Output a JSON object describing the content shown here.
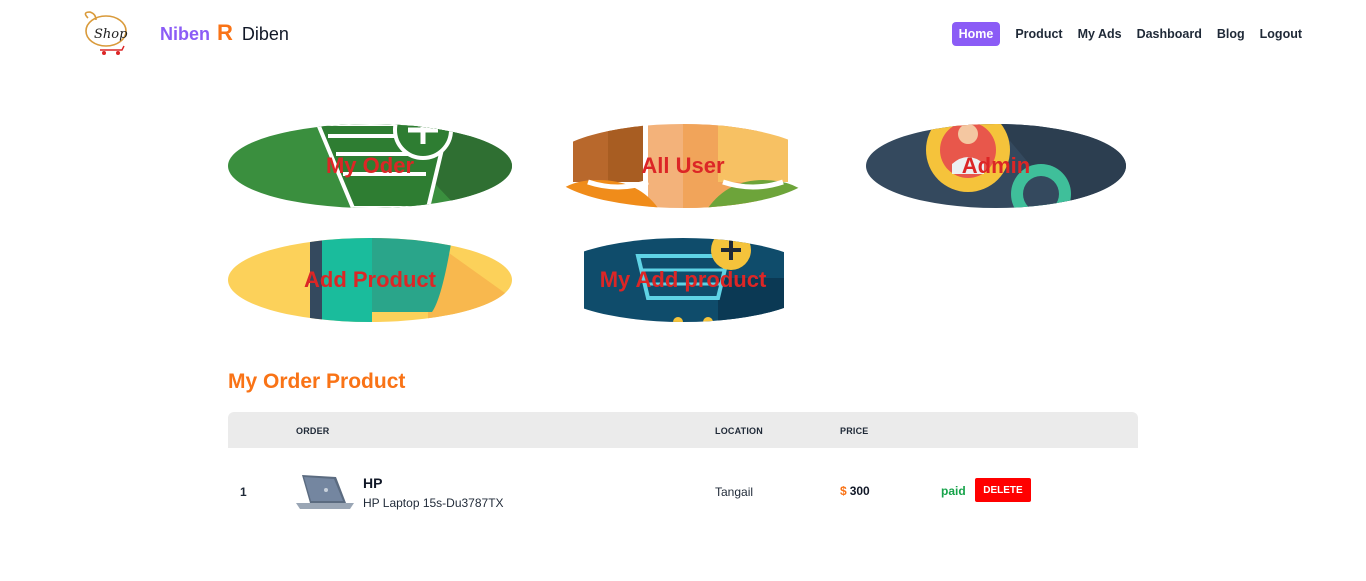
{
  "brand": {
    "part1": "Niben",
    "part2": "R",
    "part3": "Diben",
    "logo_text": "Shop"
  },
  "nav": {
    "items": [
      {
        "label": "Home",
        "active": true
      },
      {
        "label": "Product"
      },
      {
        "label": "My Ads"
      },
      {
        "label": "Dashboard"
      },
      {
        "label": "Blog"
      },
      {
        "label": "Logout"
      }
    ]
  },
  "cards": [
    {
      "label": "My Oder",
      "icon": "cart-add-icon"
    },
    {
      "label": "All User",
      "icon": "users-icon"
    },
    {
      "label": "Admin",
      "icon": "admin-gear-icon"
    },
    {
      "label": "Add Product",
      "icon": "add-product-icon"
    },
    {
      "label": "My Add product",
      "icon": "cart-plus-icon"
    }
  ],
  "orders": {
    "title": "My Order Product",
    "columns": [
      "ORDER",
      "LOCATION",
      "PRICE"
    ],
    "rows": [
      {
        "index": "1",
        "name": "HP",
        "description": "HP Laptop 15s-Du3787TX",
        "location": "Tangail",
        "currency": "$",
        "price": "300",
        "status": "paid",
        "action": "DELETE"
      }
    ]
  },
  "colors": {
    "accent": "#8b5cf6",
    "brand_orange": "#f97316",
    "label_red": "#dc2626",
    "paid_green": "#16a34a",
    "delete_red": "#ff0000"
  }
}
